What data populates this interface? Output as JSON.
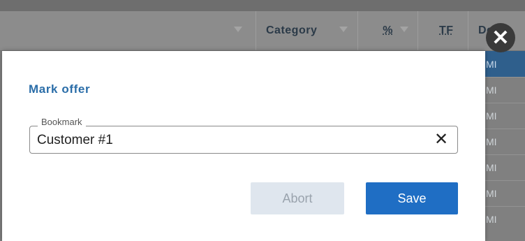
{
  "table": {
    "columns": [
      {
        "label": ""
      },
      {
        "label": "Category"
      },
      {
        "label": "%"
      },
      {
        "label": "TF"
      },
      {
        "label": "Desi..."
      }
    ],
    "visible_cells": [
      "MI",
      "MI",
      "MI",
      "MI",
      "MI",
      "MI",
      "MI"
    ]
  },
  "dialog": {
    "title": "Mark offer",
    "bookmark_field": {
      "label": "Bookmark",
      "value": "Customer #1",
      "clear_icon": "✕"
    },
    "abort_label": "Abort",
    "save_label": "Save",
    "close_icon": "✕"
  },
  "colors": {
    "title_blue": "#2a6da8",
    "save_blue": "#1f6ec4",
    "abort_gray": "#dfe6ee"
  }
}
